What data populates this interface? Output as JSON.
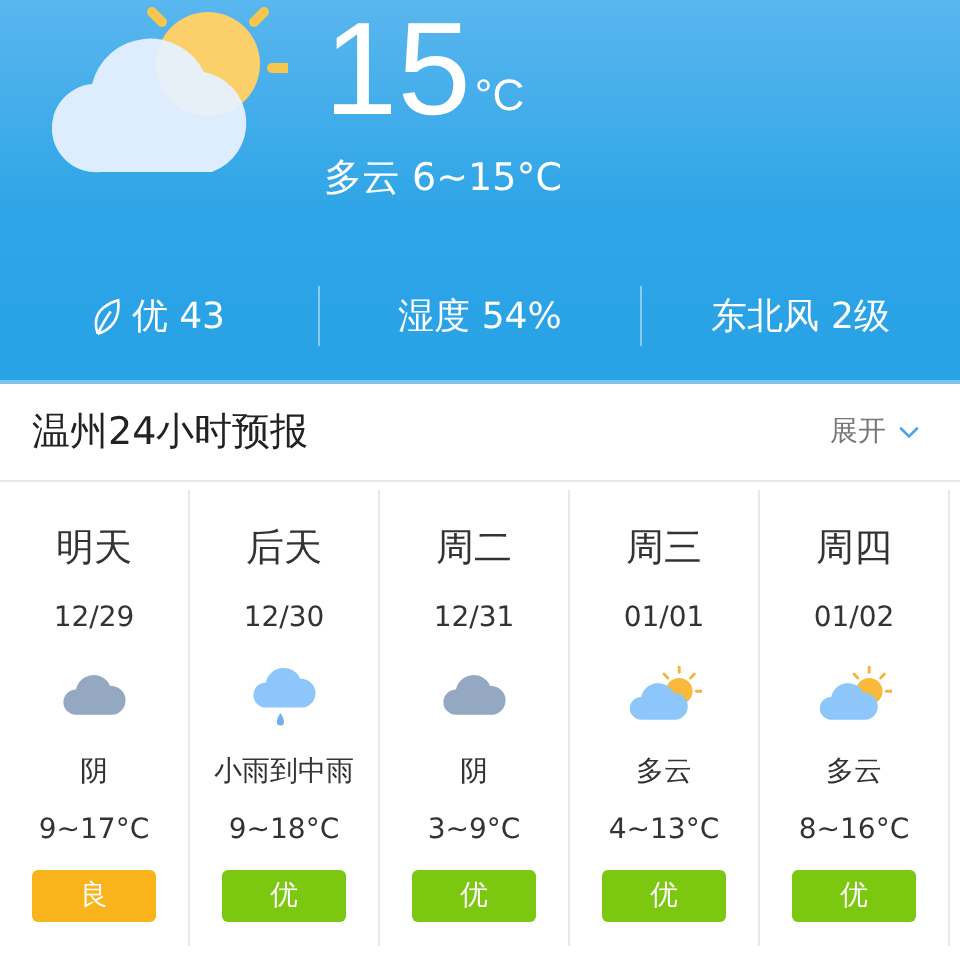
{
  "current": {
    "kind": "partly-cloudy",
    "temperature": "15",
    "unit": "°C",
    "summary": "多云 6~15°C"
  },
  "stats": [
    {
      "kind": "aqi",
      "text": "优 43"
    },
    {
      "kind": "plain",
      "text": "湿度 54%"
    },
    {
      "kind": "plain",
      "text": "东北风 2级"
    }
  ],
  "forecast_header": {
    "title": "温州24小时预报",
    "toggle": "展开"
  },
  "days": [
    {
      "day": "明天",
      "date": "12/29",
      "kind": "overcast",
      "condition": "阴",
      "temps": "9~17°C",
      "aqi": "良",
      "color": "#f9b31b"
    },
    {
      "day": "后天",
      "date": "12/30",
      "kind": "rain",
      "condition": "小雨到中雨",
      "temps": "9~18°C",
      "aqi": "优",
      "color": "#7cc70f"
    },
    {
      "day": "周二",
      "date": "12/31",
      "kind": "overcast",
      "condition": "阴",
      "temps": "3~9°C",
      "aqi": "优",
      "color": "#7cc70f"
    },
    {
      "day": "周三",
      "date": "01/01",
      "kind": "partly-cloudy",
      "condition": "多云",
      "temps": "4~13°C",
      "aqi": "优",
      "color": "#7cc70f"
    },
    {
      "day": "周四",
      "date": "01/02",
      "kind": "partly-cloudy",
      "condition": "多云",
      "temps": "8~16°C",
      "aqi": "优",
      "color": "#7cc70f"
    }
  ]
}
